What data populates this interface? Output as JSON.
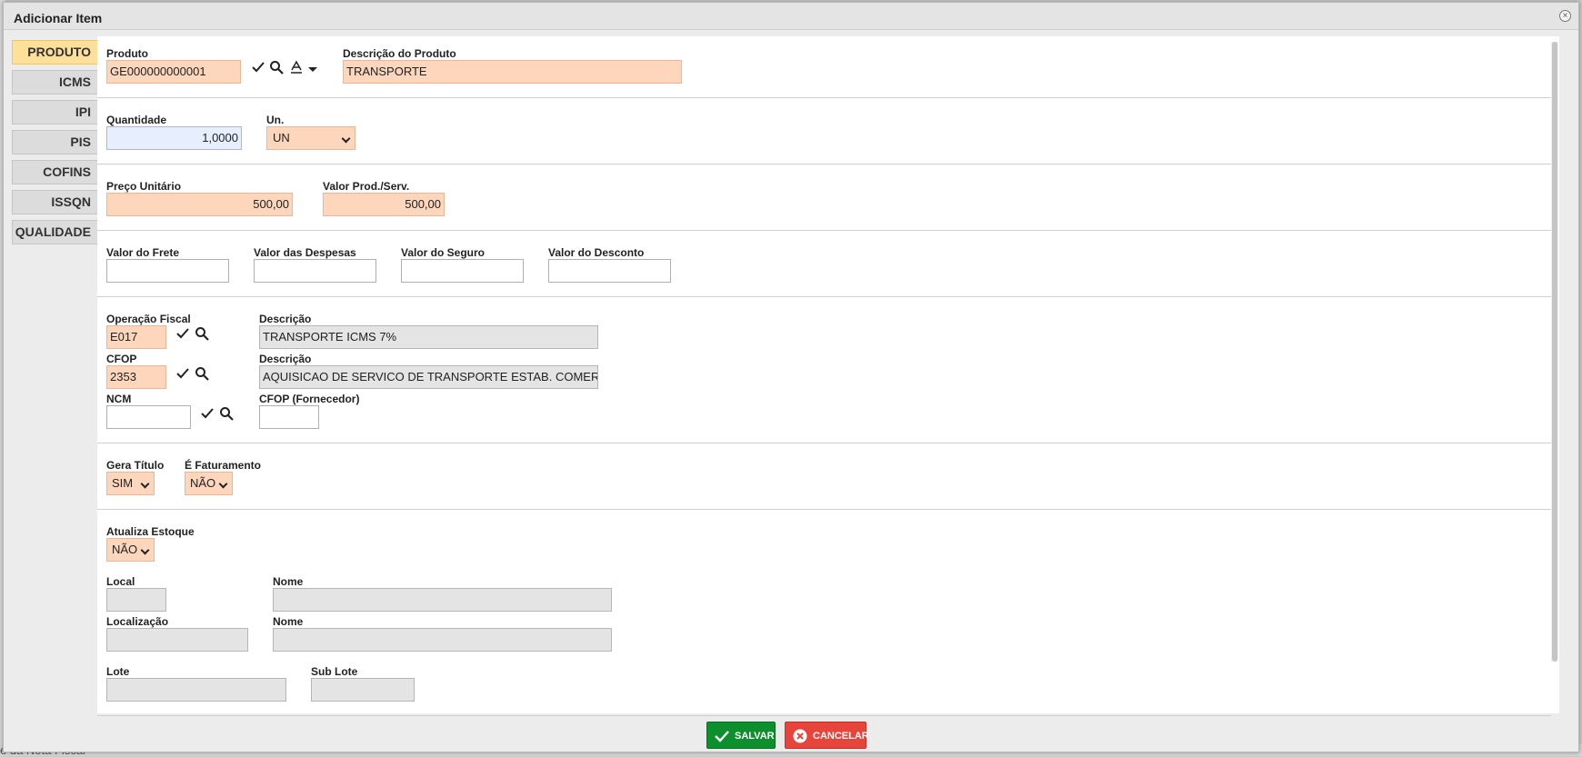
{
  "dialog": {
    "title": "Adicionar Item"
  },
  "tabs": [
    {
      "label": "PRODUTO",
      "active": true
    },
    {
      "label": "ICMS"
    },
    {
      "label": "IPI"
    },
    {
      "label": "PIS"
    },
    {
      "label": "COFINS"
    },
    {
      "label": "ISSQN"
    },
    {
      "label": "QUALIDADE"
    }
  ],
  "produto": {
    "label": "Produto",
    "value": "GE000000000001",
    "desc_label": "Descrição do Produto",
    "desc_value": "TRANSPORTE"
  },
  "quantidade": {
    "label": "Quantidade",
    "value": "1,0000"
  },
  "unidade": {
    "label": "Un.",
    "value": "UN"
  },
  "preco": {
    "label": "Preço Unitário",
    "value": "500,00"
  },
  "valor_prod": {
    "label": "Valor Prod./Serv.",
    "value": "500,00"
  },
  "valores": {
    "frete": {
      "label": "Valor do Frete",
      "value": ""
    },
    "despesas": {
      "label": "Valor das Despesas",
      "value": ""
    },
    "seguro": {
      "label": "Valor do Seguro",
      "value": ""
    },
    "desconto": {
      "label": "Valor do Desconto",
      "value": ""
    }
  },
  "fiscal": {
    "operacao_label": "Operação Fiscal",
    "operacao_value": "E017",
    "operacao_desc_label": "Descrição",
    "operacao_desc_value": "TRANSPORTE ICMS 7%",
    "cfop_label": "CFOP",
    "cfop_value": "2353",
    "cfop_desc_label": "Descrição",
    "cfop_desc_value": "AQUISICAO DE SERVICO DE TRANSPORTE  ESTAB.  COMERCIA",
    "ncm_label": "NCM",
    "ncm_value": "",
    "cfop_forn_label": "CFOP (Fornecedor)",
    "cfop_forn_value": ""
  },
  "titulo": {
    "label": "Gera Título",
    "value": "SIM"
  },
  "faturamento": {
    "label": "É Faturamento",
    "value": "NÃO"
  },
  "estoque": {
    "label": "Atualiza Estoque",
    "value": "NÃO",
    "local_label": "Local",
    "local_value": "",
    "local_nome_label": "Nome",
    "local_nome_value": "",
    "localizacao_label": "Localização",
    "localizacao_value": "",
    "localizacao_nome_label": "Nome",
    "localizacao_nome_value": "",
    "lote_label": "Lote",
    "lote_value": "",
    "sublote_label": "Sub Lote",
    "sublote_value": ""
  },
  "buttons": {
    "save": "SALVAR",
    "cancel": "CANCELAR"
  },
  "background": {
    "footer_text": "e da Nota Fiscal"
  },
  "colors": {
    "required_field": "#fdd6bc",
    "active_tab": "#ffe09a",
    "save": "#0e8f2e",
    "cancel": "#e7453b"
  }
}
